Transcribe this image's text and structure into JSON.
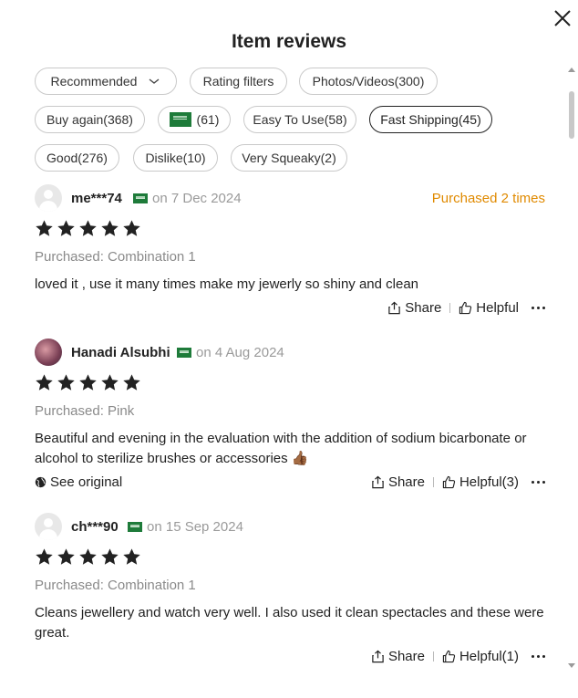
{
  "header": {
    "title": "Item reviews"
  },
  "filters": {
    "sort_label": "Recommended",
    "rating_filters": "Rating filters",
    "photos_videos": "Photos/Videos(300)",
    "buy_again": "Buy again(368)",
    "country_count": "(61)",
    "easy_to_use": "Easy To Use(58)",
    "fast_shipping": "Fast Shipping(45)",
    "good": "Good(276)",
    "dislike": "Dislike(10)",
    "very_squeaky": "Very Squeaky(2)"
  },
  "reviews": [
    {
      "user": "me***74",
      "date": "on 7 Dec 2024",
      "purchased_times": "Purchased 2 times",
      "rating": 5,
      "variant": "Purchased: Combination 1",
      "text": "loved it , use it many times make my jewerly so shiny and clean",
      "share_label": "Share",
      "helpful_label": "Helpful"
    },
    {
      "user": "Hanadi Alsubhi",
      "date": "on 4 Aug 2024",
      "rating": 5,
      "variant": "Purchased: Pink",
      "text": "Beautiful and evening in the evaluation with the addition of sodium bicarbonate or alcohol to sterilize brushes or accessories 👍🏾",
      "see_original": "See original",
      "share_label": "Share",
      "helpful_label": "Helpful(3)"
    },
    {
      "user": "ch***90",
      "date": "on 15 Sep 2024",
      "rating": 5,
      "variant": "Purchased: Combination 1",
      "text": "Cleans jewellery and watch very well. I also used it clean spectacles and these were great.",
      "share_label": "Share",
      "helpful_label": "Helpful(1)"
    }
  ],
  "colors": {
    "accent_orange": "#e08a00",
    "flag_green": "#1e7b3a",
    "muted_text": "#9a9a9a"
  },
  "icons": [
    "close-icon",
    "chevron-down-icon",
    "saudi-flag-icon",
    "star-icon",
    "share-icon",
    "thumbs-up-icon",
    "more-icon",
    "globe-icon",
    "default-avatar-icon"
  ]
}
